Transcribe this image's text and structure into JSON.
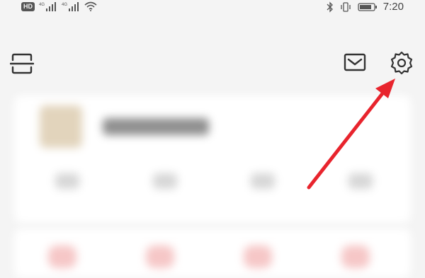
{
  "status_bar": {
    "left_badge": "HD",
    "signal_1": "4G",
    "signal_2": "4G",
    "time": "7:20"
  },
  "toolbar": {
    "scan_icon": "scan-icon",
    "mail_icon": "mail-icon",
    "settings_icon": "gear-icon"
  },
  "annotation": {
    "arrow_color": "#e8242d"
  },
  "colors": {
    "background": "#f4f4f4",
    "card": "#ffffff",
    "icon": "#333333"
  }
}
